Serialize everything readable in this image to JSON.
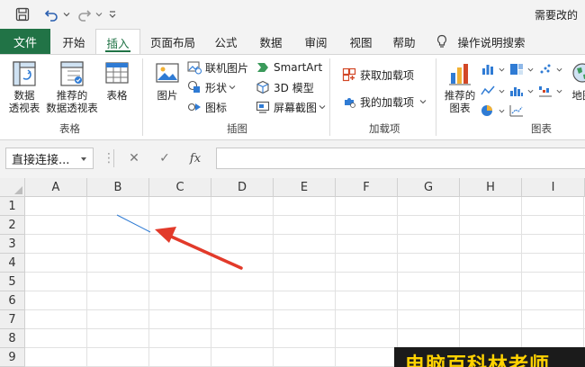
{
  "titlebar": {
    "title": "需要改的"
  },
  "tabs": {
    "file": "文件",
    "items": [
      "开始",
      "插入",
      "页面布局",
      "公式",
      "数据",
      "审阅",
      "视图",
      "帮助"
    ],
    "active_index": 1,
    "search": "操作说明搜索"
  },
  "ribbon": {
    "tables": {
      "pivot_table": "数据\n透视表",
      "recommended_pivot": "推荐的\n数据透视表",
      "table": "表格",
      "label": "表格"
    },
    "illustrations": {
      "picture": "图片",
      "online_picture": "联机图片",
      "shapes": "形状",
      "icons": "图标",
      "smartart": "SmartArt",
      "models_3d": "3D 模型",
      "screenshot": "屏幕截图",
      "label": "插图"
    },
    "addins": {
      "get_addins": "获取加载项",
      "my_addins": "我的加载项",
      "label": "加载项"
    },
    "charts": {
      "recommended": "推荐的\n图表",
      "maps": "地图",
      "label": "图表"
    },
    "colors": {
      "accent_green": "#217346",
      "chart_blue": "#2f7bd4",
      "addin_orange": "#d24726"
    }
  },
  "formula_bar": {
    "name_box": "直接连接...",
    "cancel_glyph": "✕",
    "enter_glyph": "✓",
    "function_label": "fx",
    "formula": ""
  },
  "sheet": {
    "columns": [
      "A",
      "B",
      "C",
      "D",
      "E",
      "F",
      "G",
      "H",
      "I"
    ],
    "rows": [
      "1",
      "2",
      "3",
      "4",
      "5",
      "6",
      "7",
      "8",
      "9"
    ],
    "annotation_color": "#e23a2a"
  },
  "watermark": {
    "text": "电脑百科林老师"
  }
}
